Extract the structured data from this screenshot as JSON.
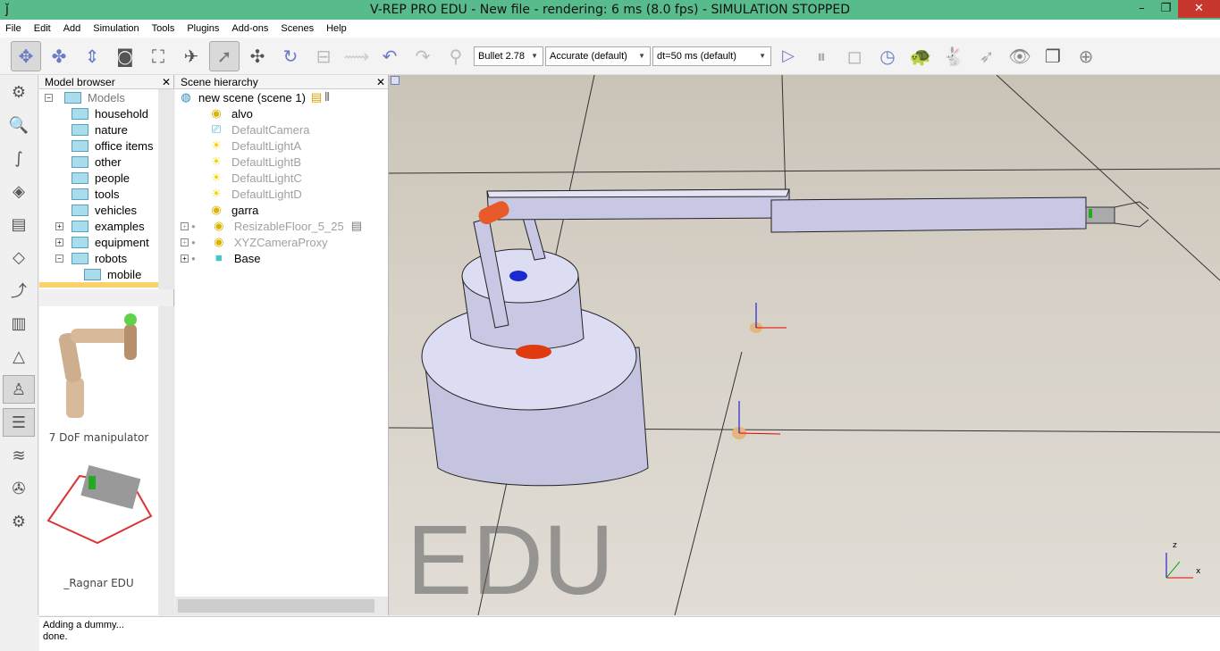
{
  "window": {
    "title": "V-REP PRO EDU - New file - rendering: 6 ms (8.0 fps) - SIMULATION STOPPED",
    "minimize": "–",
    "maximize": "❐",
    "close": "✕"
  },
  "menu": [
    "File",
    "Edit",
    "Add",
    "Simulation",
    "Tools",
    "Plugins",
    "Add-ons",
    "Scenes",
    "Help"
  ],
  "toolbar": {
    "engine": "Bullet 2.78",
    "accuracy": "Accurate (default)",
    "dt": "dt=50 ms (default)"
  },
  "model_browser": {
    "title": "Model browser",
    "close": "✕",
    "root": "Models",
    "folders": [
      "household",
      "nature",
      "office items",
      "other",
      "people",
      "tools",
      "vehicles",
      "examples",
      "equipment",
      "robots"
    ],
    "subfolder": "mobile",
    "thumbnails": [
      "7 DoF manipulator",
      "_Ragnar EDU"
    ]
  },
  "scene_hierarchy": {
    "title": "Scene hierarchy",
    "close": "✕",
    "scene": "new scene (scene 1)",
    "objects": [
      {
        "name": "alvo",
        "dim": false
      },
      {
        "name": "DefaultCamera",
        "dim": true
      },
      {
        "name": "DefaultLightA",
        "dim": true
      },
      {
        "name": "DefaultLightB",
        "dim": true
      },
      {
        "name": "DefaultLightC",
        "dim": true
      },
      {
        "name": "DefaultLightD",
        "dim": true
      },
      {
        "name": "garra",
        "dim": false
      },
      {
        "name": "ResizableFloor_5_25",
        "dim": true
      },
      {
        "name": "XYZCameraProxy",
        "dim": true
      },
      {
        "name": "Base",
        "dim": false
      }
    ]
  },
  "viewport": {
    "watermark": "EDU",
    "axis_z": "z",
    "axis_x": "x"
  },
  "console": {
    "lines": [
      "Adding a dummy...",
      "done."
    ]
  }
}
